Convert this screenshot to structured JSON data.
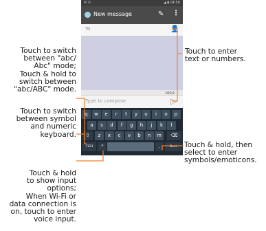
{
  "callouts": {
    "case_switch": "Touch to switch\nbetween \"abc/\nAbc\" mode;\nTouch & hold to\nswitch between\n\"abc/ABC\" mode.",
    "symbol_switch": "Touch to switch\nbetween symbol\nand numeric\nkeyboard.",
    "input_options": "Touch & hold\nto show input\noptions;\nWhen Wi-Fi or\ndata connection is\non, touch to enter\nvoice input.",
    "enter_text": "Touch to enter\ntext or numbers.",
    "emoticons": "Touch & hold, then\nselect to enter\nsymbols/emoticons."
  },
  "phone": {
    "status_right": "◢ ▮ 04:56",
    "status_left": "✉ ⊙",
    "title": "New message",
    "to_label": "To",
    "counter": "160/1",
    "compose_placeholder": "Type to compose",
    "icons": {
      "app": "app-icon",
      "attach": "paperclip-icon",
      "menu": "overflow-menu-icon",
      "contact": "add-contact-icon",
      "send": "send-icon",
      "mic": "microphone-icon",
      "shift": "shift-icon",
      "backspace": "backspace-icon"
    },
    "keyboard": {
      "row1": [
        "q",
        "w",
        "e",
        "r",
        "t",
        "y",
        "u",
        "i",
        "o",
        "p"
      ],
      "row2": [
        "a",
        "s",
        "d",
        "f",
        "g",
        "h",
        "j",
        "k",
        "l"
      ],
      "row3": [
        "z",
        "x",
        "c",
        "v",
        "b",
        "n",
        "m"
      ],
      "symbols_key": "?123",
      "period_key": ".",
      "next_key": "Next",
      "shift_glyph": "⇧",
      "backspace_glyph": "⌫",
      "mic_glyph": "🎤"
    }
  },
  "colors": {
    "leader": "#f07f2b",
    "keyboard_bg": "#1f2a35",
    "key_bg": "#3f4f5e",
    "appbar": "#4a4a4a"
  }
}
